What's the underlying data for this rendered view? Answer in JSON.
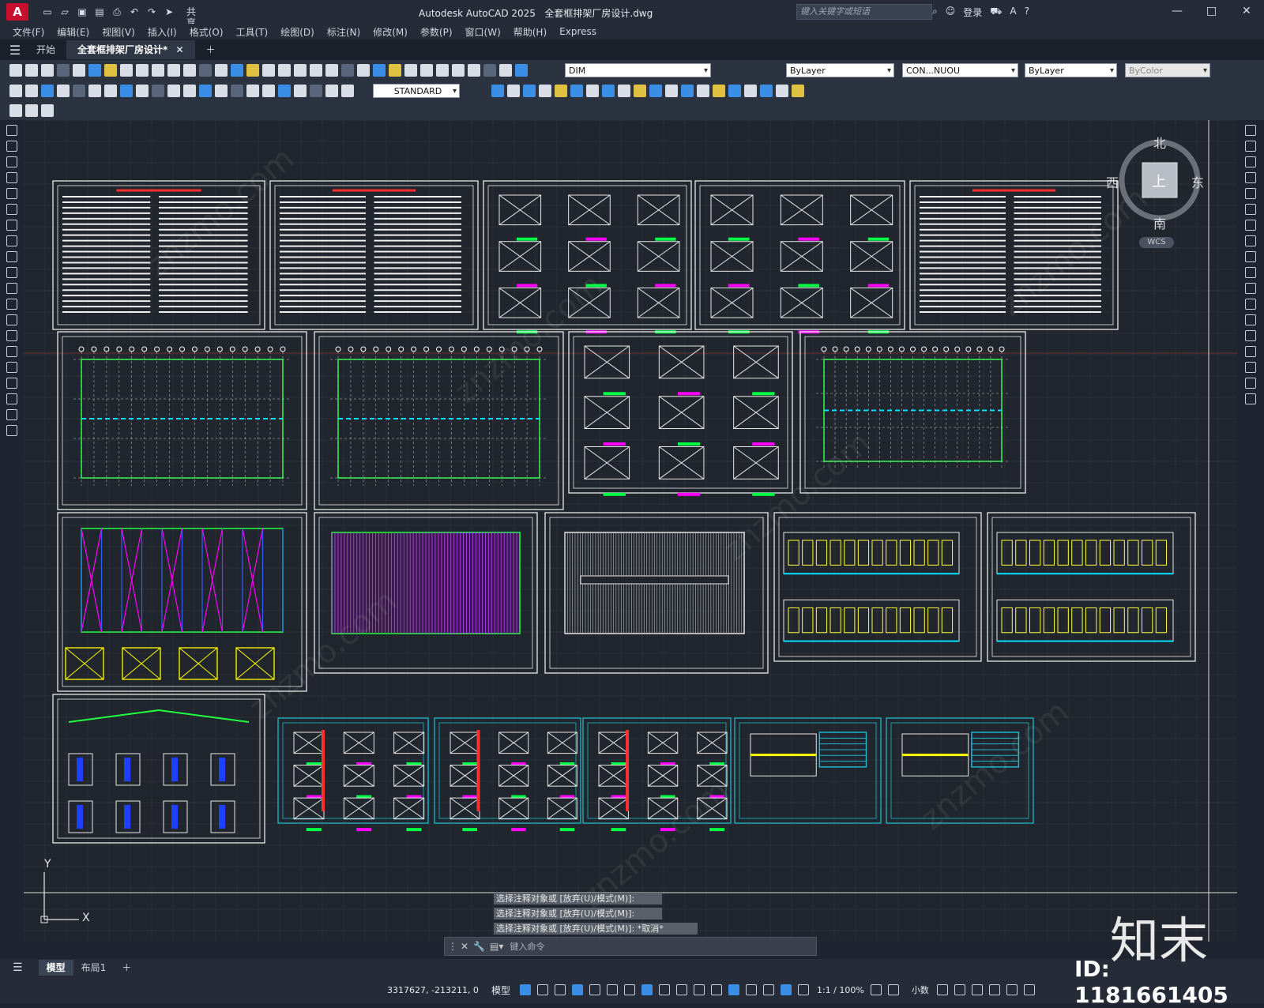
{
  "app": {
    "logo": "A",
    "title": "Autodesk AutoCAD 2025",
    "file": "全套框排架厂房设计.dwg",
    "share": "共享",
    "search_placeholder": "键入关键字或短语",
    "login": "登录"
  },
  "menu": [
    "文件(F)",
    "编辑(E)",
    "视图(V)",
    "插入(I)",
    "格式(O)",
    "工具(T)",
    "绘图(D)",
    "标注(N)",
    "修改(M)",
    "参数(P)",
    "窗口(W)",
    "帮助(H)",
    "Express"
  ],
  "tabs": {
    "start": "开始",
    "active": "全套框排架厂房设计*"
  },
  "toolbar": {
    "layer": "DIM",
    "color": "ByLayer",
    "linetype": "CON...NUOU",
    "lineweight": "ByLayer",
    "plotstyle": "ByColor",
    "textstyle": "STANDARD"
  },
  "viewcube": {
    "north": "北",
    "south": "南",
    "east": "东",
    "west": "西",
    "top": "上",
    "wcs": "WCS"
  },
  "ucs": {
    "x": "X",
    "y": "Y"
  },
  "command": {
    "history": [
      "选择注释对象或 [放弃(U)/模式(M)]:",
      "选择注释对象或 [放弃(U)/模式(M)]:",
      "选择注释对象或 [放弃(U)/模式(M)]: *取消*"
    ],
    "placeholder": "键入命令"
  },
  "layouts": {
    "model": "模型",
    "layout1": "布局1"
  },
  "status": {
    "coords": "3317627, -213211, 0",
    "model": "模型",
    "scale": "1:1 / 100%",
    "units": "小数"
  },
  "watermark": {
    "brand": "知末",
    "id": "ID: 1181661405"
  }
}
